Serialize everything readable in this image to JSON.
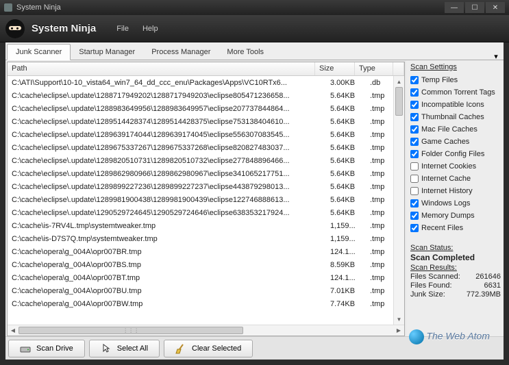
{
  "window": {
    "title": "System Ninja"
  },
  "menu": {
    "app_name": "System Ninja",
    "file": "File",
    "help": "Help"
  },
  "tabs": [
    {
      "label": "Junk Scanner",
      "active": true
    },
    {
      "label": "Startup Manager",
      "active": false
    },
    {
      "label": "Process Manager",
      "active": false
    },
    {
      "label": "More Tools",
      "active": false
    }
  ],
  "grid": {
    "headers": {
      "path": "Path",
      "size": "Size",
      "type": "Type"
    },
    "rows": [
      {
        "path": "C:\\ATI\\Support\\10-10_vista64_win7_64_dd_ccc_enu\\Packages\\Apps\\VC10RTx6...",
        "size": "3.00KB",
        "type": ".db"
      },
      {
        "path": "C:\\cache\\eclipse\\.update\\1288717949202\\1288717949203\\eclipse805471236658...",
        "size": "5.64KB",
        "type": ".tmp"
      },
      {
        "path": "C:\\cache\\eclipse\\.update\\1288983649956\\1288983649957\\eclipse207737844864...",
        "size": "5.64KB",
        "type": ".tmp"
      },
      {
        "path": "C:\\cache\\eclipse\\.update\\1289514428374\\1289514428375\\eclipse753138404610...",
        "size": "5.64KB",
        "type": ".tmp"
      },
      {
        "path": "C:\\cache\\eclipse\\.update\\1289639174044\\1289639174045\\eclipse556307083545...",
        "size": "5.64KB",
        "type": ".tmp"
      },
      {
        "path": "C:\\cache\\eclipse\\.update\\1289675337267\\1289675337268\\eclipse820827483037...",
        "size": "5.64KB",
        "type": ".tmp"
      },
      {
        "path": "C:\\cache\\eclipse\\.update\\1289820510731\\1289820510732\\eclipse277848896466...",
        "size": "5.64KB",
        "type": ".tmp"
      },
      {
        "path": "C:\\cache\\eclipse\\.update\\1289862980966\\1289862980967\\eclipse341065217751...",
        "size": "5.64KB",
        "type": ".tmp"
      },
      {
        "path": "C:\\cache\\eclipse\\.update\\1289899227236\\1289899227237\\eclipse443879298013...",
        "size": "5.64KB",
        "type": ".tmp"
      },
      {
        "path": "C:\\cache\\eclipse\\.update\\1289981900438\\1289981900439\\eclipse122746888613...",
        "size": "5.64KB",
        "type": ".tmp"
      },
      {
        "path": "C:\\cache\\eclipse\\.update\\1290529724645\\1290529724646\\eclipse638353217924...",
        "size": "5.64KB",
        "type": ".tmp"
      },
      {
        "path": "C:\\cache\\is-7RV4L.tmp\\systemtweaker.tmp",
        "size": "1,159...",
        "type": ".tmp"
      },
      {
        "path": "C:\\cache\\is-D7S7Q.tmp\\systemtweaker.tmp",
        "size": "1,159...",
        "type": ".tmp"
      },
      {
        "path": "C:\\cache\\opera\\g_004A\\opr007BR.tmp",
        "size": "124.1...",
        "type": ".tmp"
      },
      {
        "path": "C:\\cache\\opera\\g_004A\\opr007BS.tmp",
        "size": "8.59KB",
        "type": ".tmp"
      },
      {
        "path": "C:\\cache\\opera\\g_004A\\opr007BT.tmp",
        "size": "124.1...",
        "type": ".tmp"
      },
      {
        "path": "C:\\cache\\opera\\g_004A\\opr007BU.tmp",
        "size": "7.01KB",
        "type": ".tmp"
      },
      {
        "path": "C:\\cache\\opera\\g_004A\\opr007BW.tmp",
        "size": "7.74KB",
        "type": ".tmp"
      }
    ]
  },
  "settings": {
    "title": "Scan Settings",
    "items": [
      {
        "label": "Temp Files",
        "checked": true
      },
      {
        "label": "Common Torrent Tags",
        "checked": true
      },
      {
        "label": "Incompatible Icons",
        "checked": true
      },
      {
        "label": "Thumbnail Caches",
        "checked": true
      },
      {
        "label": "Mac File Caches",
        "checked": true
      },
      {
        "label": "Game Caches",
        "checked": true
      },
      {
        "label": "Folder Config Files",
        "checked": true
      },
      {
        "label": "Internet Cookies",
        "checked": false
      },
      {
        "label": "Internet Cache",
        "checked": false
      },
      {
        "label": "Internet History",
        "checked": false
      },
      {
        "label": "Windows Logs",
        "checked": true
      },
      {
        "label": "Memory Dumps",
        "checked": true
      },
      {
        "label": "Recent Files",
        "checked": true
      }
    ]
  },
  "status": {
    "title": "Scan Status:",
    "main": "Scan Completed",
    "results_title": "Scan Results:",
    "scanned_label": "Files Scanned:",
    "scanned_value": "261646",
    "found_label": "Files Found:",
    "found_value": "6631",
    "junk_label": "Junk Size:",
    "junk_value": "772.39MB"
  },
  "buttons": {
    "scan": "Scan Drive",
    "select_all": "Select All",
    "clear": "Clear Selected"
  },
  "watermark": "The Web Atom"
}
